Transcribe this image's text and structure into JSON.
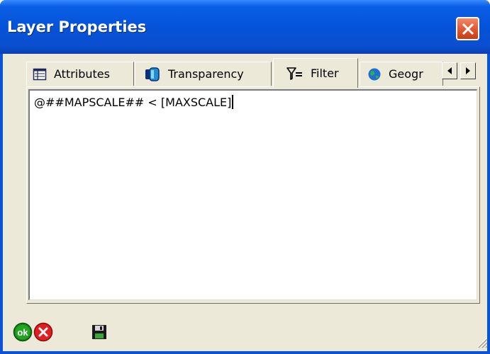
{
  "window": {
    "title": "Layer Properties"
  },
  "tabs": [
    {
      "label": "Attributes",
      "icon": "table-icon",
      "active": false
    },
    {
      "label": "Transparency",
      "icon": "transparency-icon",
      "active": false
    },
    {
      "label": "Filter",
      "icon": "filter-icon",
      "active": true
    },
    {
      "label": "Geogr",
      "icon": "globe-icon",
      "active": false
    }
  ],
  "editor": {
    "value": "@##MAPSCALE## < [MAXSCALE]"
  },
  "footer": {
    "ok_label": "ok",
    "icons": [
      "ok-icon",
      "cancel-icon",
      "save-icon"
    ]
  },
  "colors": {
    "title_bar": "#0553d8",
    "close_button": "#e25a33",
    "ok_green": "#1a8c1a",
    "cancel_red": "#e02020"
  }
}
